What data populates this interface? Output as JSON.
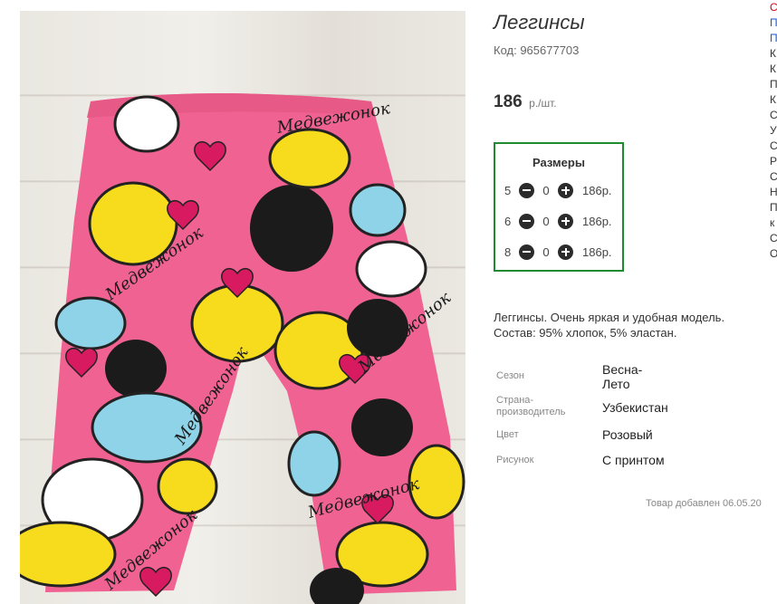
{
  "product": {
    "title": "Леггинсы",
    "code": "Код: 965677703",
    "price": "186",
    "price_unit": "р./шт.",
    "description": "Леггинсы. Очень яркая и удобная модель.\nСостав: 95% хлопок, 5% эластан.",
    "added": "Товар добавлен 06.05.20"
  },
  "sizes": {
    "title": "Размеры",
    "rows": [
      {
        "size": "5",
        "qty": "0",
        "price": "186р."
      },
      {
        "size": "6",
        "qty": "0",
        "price": "186р."
      },
      {
        "size": "8",
        "qty": "0",
        "price": "186р."
      }
    ]
  },
  "properties": [
    {
      "name": "Сезон",
      "value": "Весна-\nЛето"
    },
    {
      "name": "Страна-\nпроизводитель",
      "value": "Узбекистан"
    },
    {
      "name": "Цвет",
      "value": "Розовый"
    },
    {
      "name": "Рисунок",
      "value": "С принтом"
    }
  ],
  "photo": {
    "print_text": "Медвежонок",
    "main_color": "#f06292"
  },
  "side_nav": {
    "items": [
      "С",
      "П",
      "П",
      "К",
      "К",
      "П",
      "К",
      "С",
      "У",
      "С",
      "Р",
      "С",
      "Н",
      "П",
      "к",
      "С",
      "О"
    ],
    "colors": [
      "#d0021b",
      "#1a56c8",
      "#1a56c8"
    ]
  }
}
